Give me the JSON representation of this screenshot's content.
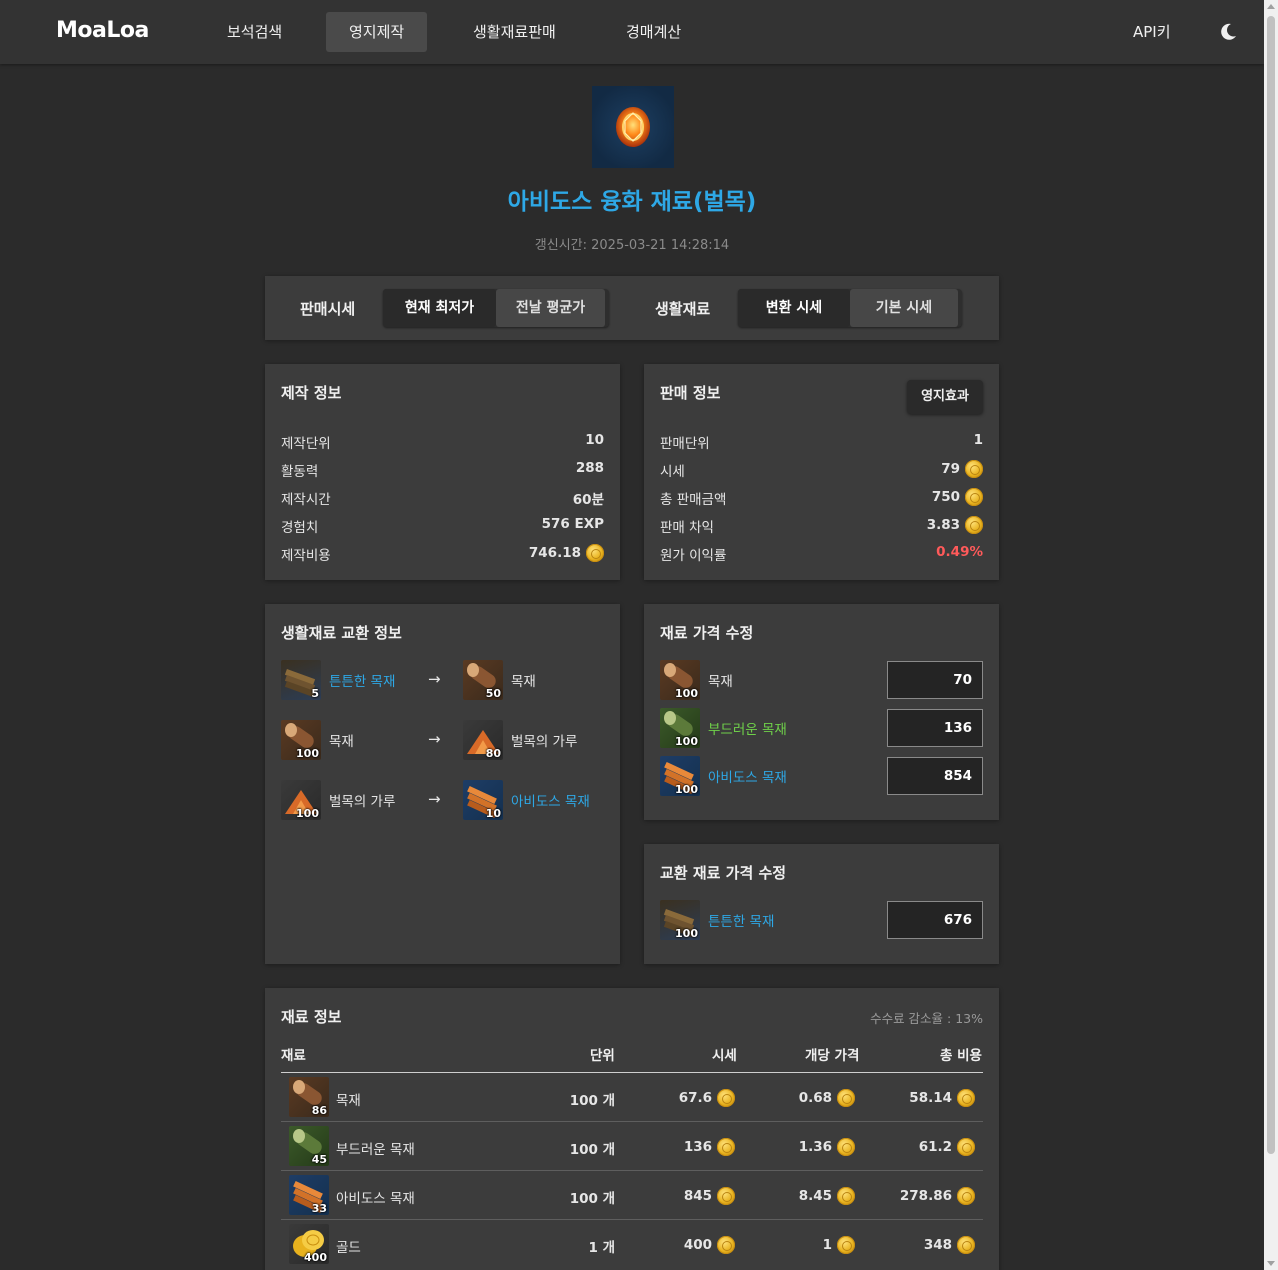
{
  "nav": {
    "logo": "MoaLoa",
    "items": [
      "보석검색",
      "영지제작",
      "생활재료판매",
      "경매계산"
    ],
    "active_index": 1,
    "api_label": "API키",
    "theme_icon": "moon-icon"
  },
  "item": {
    "title": "아비도스 융화 재료(벌목)",
    "updated": "갱신시간: 2025-03-21 14:28:14",
    "title_color": "#2ea8e6"
  },
  "toggles": {
    "sell_label": "판매시세",
    "sell_options": [
      "현재 최저가",
      "전날 평균가"
    ],
    "sell_selected": "현재 최저가",
    "material_label": "생활재료",
    "material_options": [
      "변환 시세",
      "기본 시세"
    ],
    "material_selected": "변환 시세"
  },
  "craft_info": {
    "title": "제작 정보",
    "rows": [
      {
        "label": "제작단위",
        "value": "10"
      },
      {
        "label": "활동력",
        "value": "288"
      },
      {
        "label": "제작시간",
        "value": "60분"
      },
      {
        "label": "경험치",
        "value": "576 EXP"
      },
      {
        "label": "제작비용",
        "value": "746.18"
      }
    ]
  },
  "sale_info": {
    "title": "판매 정보",
    "effect_button": "영지효과",
    "rows": [
      {
        "label": "판매단위",
        "value": "1"
      },
      {
        "label": "시세",
        "value": "79"
      },
      {
        "label": "총 판매금액",
        "value": "750"
      },
      {
        "label": "판매 차익",
        "value": "3.83"
      },
      {
        "label": "원가 이익률",
        "value": "0.49%"
      }
    ],
    "loss_color": "#ff5a5a"
  },
  "exchange_info": {
    "title": "생활재료 교환 정보",
    "arrow": "→",
    "rows": [
      {
        "from": {
          "name": "튼튼한 목재",
          "qty": "5"
        },
        "to": {
          "name": "목재",
          "qty": "50"
        }
      },
      {
        "from": {
          "name": "목재",
          "qty": "100"
        },
        "to": {
          "name": "벌목의 가루",
          "qty": "80"
        }
      },
      {
        "from": {
          "name": "벌목의 가루",
          "qty": "100"
        },
        "to": {
          "name": "아비도스 목재",
          "qty": "10"
        }
      }
    ]
  },
  "price_edit": {
    "title": "재료 가격 수정",
    "rows": [
      {
        "name": "목재",
        "qty": "100",
        "value": "70"
      },
      {
        "name": "부드러운 목재",
        "qty": "100",
        "value": "136"
      },
      {
        "name": "아비도스 목재",
        "qty": "100",
        "value": "854"
      }
    ]
  },
  "exchange_price_edit": {
    "title": "교환 재료 가격 수정",
    "rows": [
      {
        "name": "튼튼한 목재",
        "qty": "100",
        "value": "676"
      }
    ]
  },
  "material_info": {
    "title": "재료 정보",
    "fee_note": "수수료 감소율 : 13%",
    "headers": [
      "재료",
      "단위",
      "시세",
      "개당 가격",
      "총 비용"
    ],
    "rows": [
      {
        "name": "목재",
        "qty": "86",
        "unit": "100 개",
        "price": "67.6",
        "each": "0.68",
        "total": "58.14"
      },
      {
        "name": "부드러운 목재",
        "qty": "45",
        "unit": "100 개",
        "price": "136",
        "each": "1.36",
        "total": "61.2"
      },
      {
        "name": "아비도스 목재",
        "qty": "33",
        "unit": "100 개",
        "price": "845",
        "each": "8.45",
        "total": "278.86"
      },
      {
        "name": "골드",
        "qty": "400",
        "unit": "1 개",
        "price": "400",
        "each": "1",
        "total": "348"
      }
    ]
  },
  "colors": {
    "accent_blue": "#2ea8e6",
    "uncommon_green": "#6fd14a",
    "loss_red": "#ff5a5a",
    "background": "#2b2b2b",
    "panel": "#3c3c3c"
  }
}
